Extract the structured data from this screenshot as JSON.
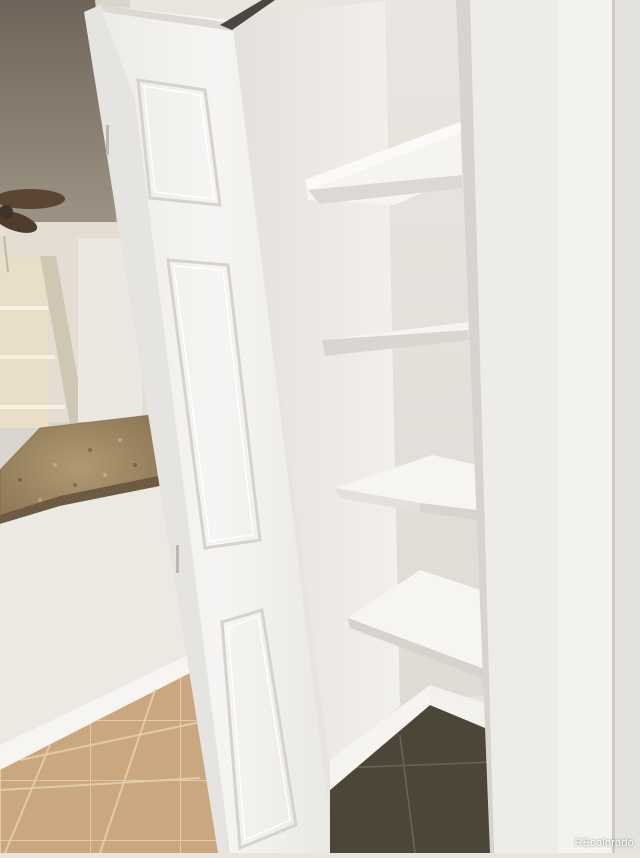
{
  "photo": {
    "subject": "",
    "watermark": "REcolorado"
  },
  "palette": {
    "wall": "#f1efec",
    "shadow_wall": "#dcd9d4",
    "door": "#f4f3f1",
    "granite": "#a08b66",
    "floor_tile_light": "#c9a57c",
    "floor_tile_dark": "#4c4639",
    "ceiling_fan": "#5b4634"
  }
}
